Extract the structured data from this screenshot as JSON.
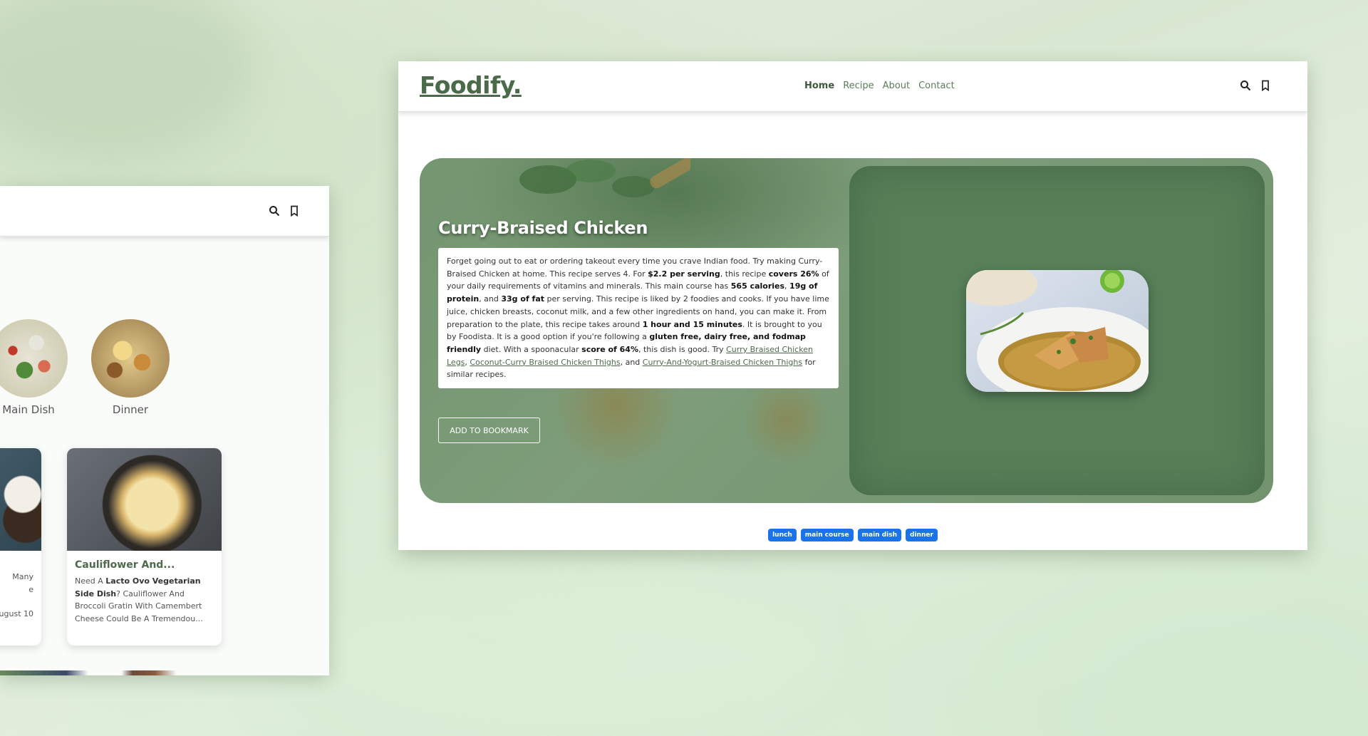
{
  "left_window": {
    "categories": [
      {
        "label": "Main Dish"
      },
      {
        "label": "Dinner"
      }
    ],
    "cards": [
      {
        "desc_lines": [
          "Many",
          "e",
          "",
          "ugust 10"
        ]
      },
      {
        "title": "Cauliflower And...",
        "desc_intro": "Need A ",
        "desc_bold": "Lacto Ovo Vegetarian Side Dish",
        "desc_rest": "? Cauliflower And Broccoli Gratin With Camembert Cheese Could Be A Tremendou..."
      }
    ]
  },
  "right_window": {
    "brand": "Foodify.",
    "nav": {
      "home": "Home",
      "recipe": "Recipe",
      "about": "About",
      "contact": "Contact"
    },
    "recipe": {
      "title": "Curry-Braised Chicken",
      "summary": {
        "p1": "Forget going out to eat or ordering takeout every time you crave Indian food. Try making Curry-Braised Chicken at home. This recipe serves 4. For ",
        "b1": "$2.2 per serving",
        "p2": ", this recipe ",
        "b2": "covers 26%",
        "p3": " of your daily requirements of vitamins and minerals. This main course has ",
        "b3": "565 calories",
        "p4": ", ",
        "b4": "19g of protein",
        "p5": ", and ",
        "b5": "33g of fat",
        "p6": " per serving. This recipe is liked by 2 foodies and cooks. If you have lime juice, chicken breasts, coconut milk, and a few other ingredients on hand, you can make it. From preparation to the plate, this recipe takes around ",
        "b6": "1 hour and 15 minutes",
        "p7": ". It is brought to you by Foodista. It is a good option if you're following a ",
        "b7": "gluten free, dairy free, and fodmap friendly",
        "p8": " diet. With a spoonacular ",
        "b8": "score of 64%",
        "p9": ", this dish is good. Try ",
        "link1": "Curry Braised Chicken Legs",
        "p10": ", ",
        "link2": "Coconut-Curry Braised Chicken Thighs",
        "p11": ", and ",
        "link3": "Curry-And-Yogurt-Braised Chicken Thighs",
        "p12": " for similar recipes."
      },
      "bookmark_button": "ADD TO BOOKMARK",
      "tags": [
        "lunch",
        "main course",
        "main dish",
        "dinner"
      ]
    }
  },
  "colors": {
    "brand_green": "#4a6a49",
    "panel_green": "#577f58",
    "tag_blue": "#1a73e8"
  }
}
